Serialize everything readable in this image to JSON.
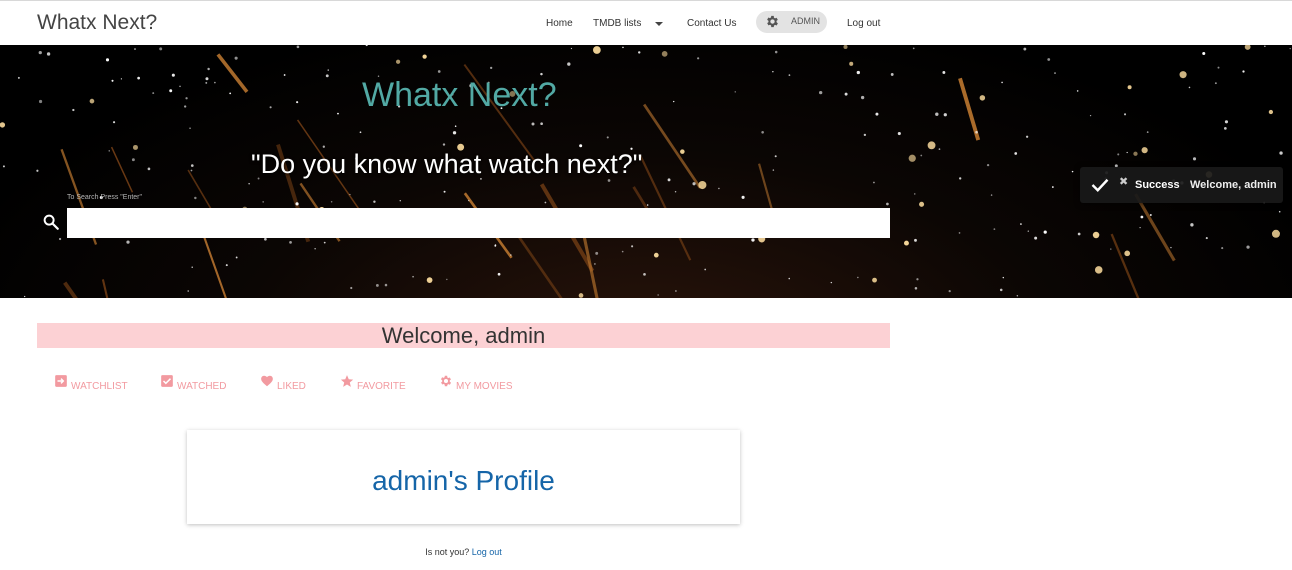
{
  "navbar": {
    "brand": "Whatx Next?",
    "links": {
      "home": "Home",
      "tmdb_lists": "TMDB lists",
      "contact": "Contact Us",
      "admin": "ADMIN",
      "logout": "Log out"
    },
    "icons": {
      "admin": "gear-icon",
      "tmdb_dropdown": "caret-down-icon"
    }
  },
  "hero": {
    "title": "Whatx Next?",
    "quote": "\"Do you know what watch next?\"",
    "search_hint": "To Search Press \"Enter\"",
    "search_value": "",
    "colors": {
      "title": "#52a9a4",
      "quote": "#ffffff"
    }
  },
  "toast": {
    "title": "Success",
    "message": "Welcome, admin",
    "icons": {
      "status": "check-icon",
      "close": "close-icon"
    }
  },
  "welcome": {
    "text": "Welcome, admin",
    "background": "#fcd1d4"
  },
  "tabs": [
    {
      "label": "WATCHLIST",
      "icon": "watchlist-icon"
    },
    {
      "label": "WATCHED",
      "icon": "checkbox-icon"
    },
    {
      "label": "LIKED",
      "icon": "heart-icon"
    },
    {
      "label": "FAVORITE",
      "icon": "star-icon"
    },
    {
      "label": "MY MOVIES",
      "icon": "gear-icon"
    }
  ],
  "tab_color": "#f29aa0",
  "profile": {
    "title": "admin's Profile",
    "title_color": "#1565a8"
  },
  "footer": {
    "prompt": "Is not you?",
    "logout": "Log out"
  }
}
